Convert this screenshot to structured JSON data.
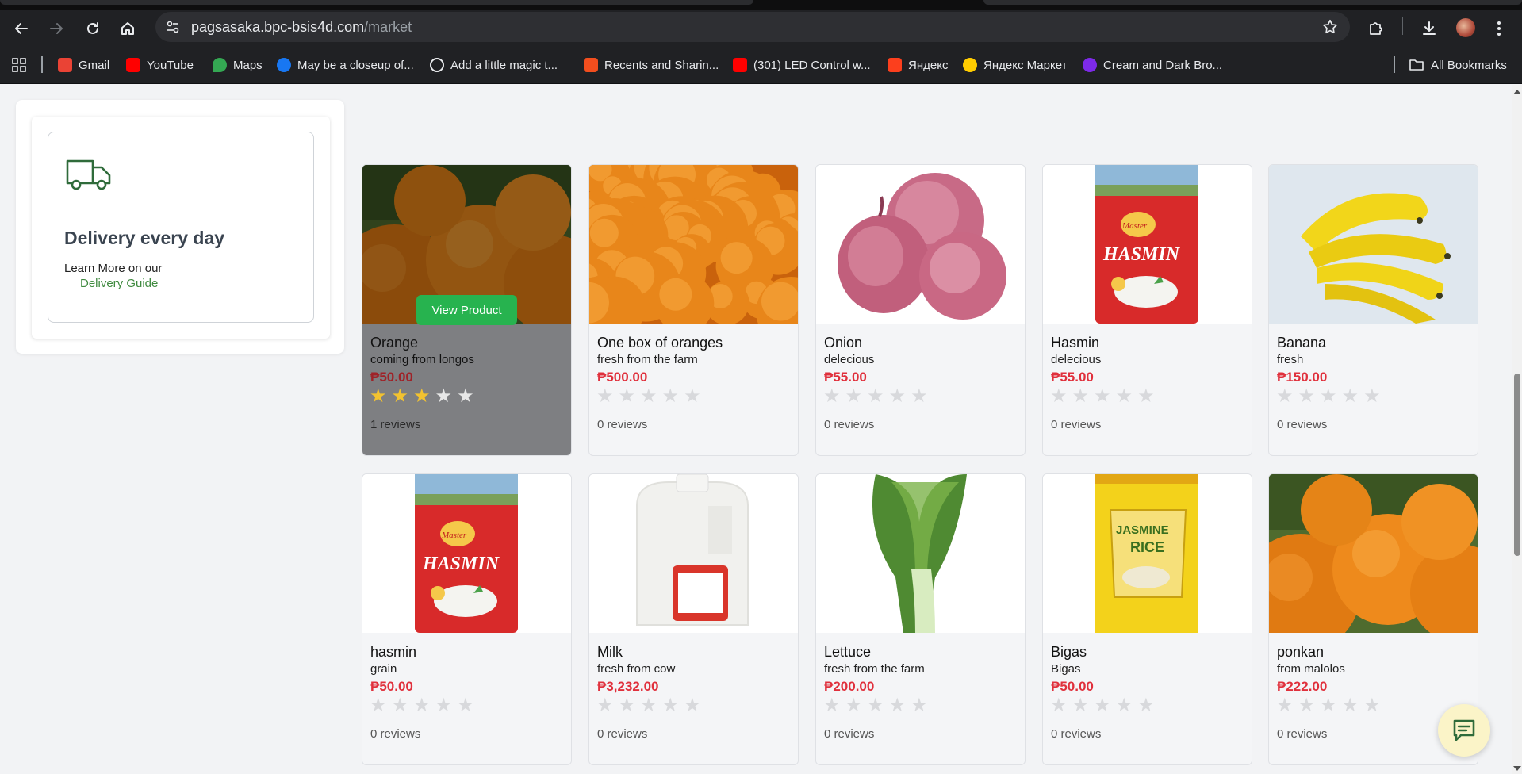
{
  "browser": {
    "url_host": "pagsasaka.bpc-bsis4d.com",
    "url_path": "/market",
    "bookmarks": [
      {
        "label": "Gmail",
        "icon": "gmail-icon",
        "color": "#ea4335"
      },
      {
        "label": "YouTube",
        "icon": "youtube-icon",
        "color": "#ff0000"
      },
      {
        "label": "Maps",
        "icon": "maps-icon",
        "color": "#34a853"
      },
      {
        "label": "May be a closeup of...",
        "icon": "facebook-icon",
        "color": "#1877f2"
      },
      {
        "label": "Add a little magic t...",
        "icon": "globe-icon",
        "color": "#e8eaed"
      },
      {
        "label": "Recents and Sharin...",
        "icon": "figma-icon",
        "color": "#f24e1e"
      },
      {
        "label": "(301) LED Control w...",
        "icon": "youtube-icon",
        "color": "#ff0000"
      },
      {
        "label": "Яндекс",
        "icon": "yandex-icon",
        "color": "#fc3f1d"
      },
      {
        "label": "Яндекс Маркет",
        "icon": "yandex-market-icon",
        "color": "#ffcc00"
      },
      {
        "label": "Cream and Dark Bro...",
        "icon": "canva-icon",
        "color": "#7d2ae8"
      }
    ],
    "all_bookmarks": "All Bookmarks"
  },
  "sidebar": {
    "delivery_title": "Delivery every day",
    "delivery_text": "Learn More on our",
    "delivery_link": "Delivery Guide"
  },
  "view_product_label": "View Product",
  "products": [
    {
      "name": "Orange",
      "desc": "coming from longos",
      "price": "₱50.00",
      "rating": 3,
      "reviews": "1 reviews",
      "image": "oranges-closeup"
    },
    {
      "name": "One box of oranges",
      "desc": "fresh from the farm",
      "price": "₱500.00",
      "rating": 0,
      "reviews": "0 reviews",
      "image": "oranges-pile"
    },
    {
      "name": "Onion",
      "desc": "delecious",
      "price": "₱55.00",
      "rating": 0,
      "reviews": "0 reviews",
      "image": "red-onions"
    },
    {
      "name": "Hasmin",
      "desc": "delecious",
      "price": "₱55.00",
      "rating": 0,
      "reviews": "0 reviews",
      "image": "rice-bag-hasmin"
    },
    {
      "name": "Banana",
      "desc": "fresh",
      "price": "₱150.00",
      "rating": 0,
      "reviews": "0 reviews",
      "image": "bananas"
    },
    {
      "name": "hasmin",
      "desc": "grain",
      "price": "₱50.00",
      "rating": 0,
      "reviews": "0 reviews",
      "image": "rice-bag-hasmin"
    },
    {
      "name": "Milk",
      "desc": "fresh from cow",
      "price": "₱3,232.00",
      "rating": 0,
      "reviews": "0 reviews",
      "image": "milk-gallon"
    },
    {
      "name": "Lettuce",
      "desc": "fresh from the farm",
      "price": "₱200.00",
      "rating": 0,
      "reviews": "0 reviews",
      "image": "lettuce"
    },
    {
      "name": "Bigas",
      "desc": "Bigas",
      "price": "₱50.00",
      "rating": 0,
      "reviews": "0 reviews",
      "image": "jasmine-rice-bag"
    },
    {
      "name": "ponkan",
      "desc": "from malolos",
      "price": "₱222.00",
      "rating": 0,
      "reviews": "0 reviews",
      "image": "oranges-closeup"
    }
  ],
  "colors": {
    "price": "#e0303c",
    "accent_green": "#27b34f",
    "star_on": "#f2c230",
    "star_off": "#d8d9dc"
  }
}
